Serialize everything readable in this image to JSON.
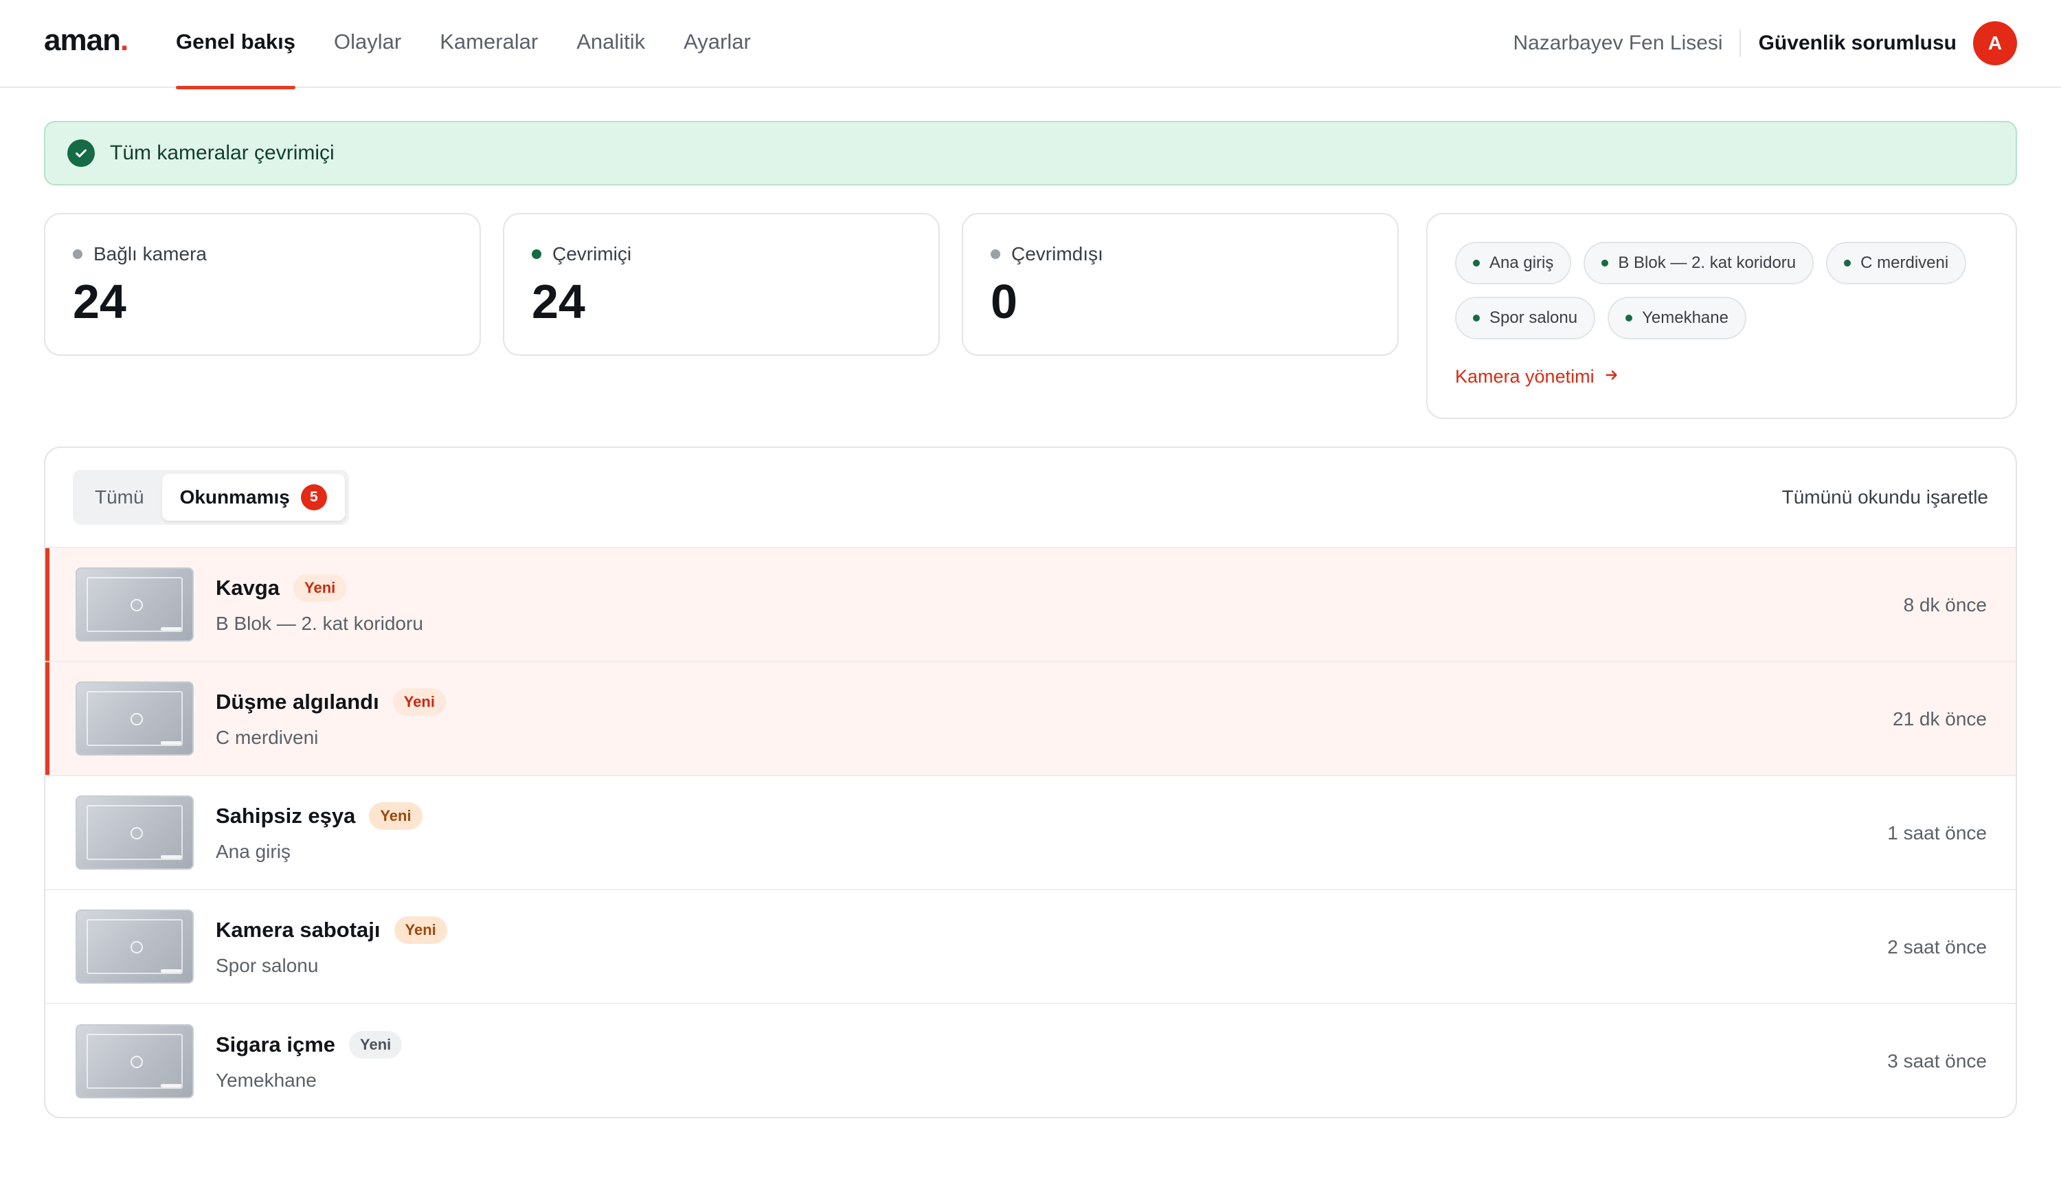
{
  "brand": {
    "name": "aman",
    "dot": "."
  },
  "nav": {
    "items": [
      {
        "label": "Genel bakış",
        "active": true
      },
      {
        "label": "Olaylar"
      },
      {
        "label": "Kameralar"
      },
      {
        "label": "Analitik"
      },
      {
        "label": "Ayarlar"
      }
    ]
  },
  "header": {
    "school": "Nazarbayev Fen Lisesi",
    "role": "Güvenlik sorumlusu",
    "avatar_initial": "A"
  },
  "banner": {
    "text": "Tüm kameralar çevrimiçi",
    "icon": "check-circle-icon"
  },
  "stats": [
    {
      "label": "Bağlı kamera",
      "value": "24",
      "dot_color": "#9aa0a6"
    },
    {
      "label": "Çevrimiçi",
      "value": "24",
      "dot_color": "#156b45"
    },
    {
      "label": "Çevrimdışı",
      "value": "0",
      "dot_color": "#9aa0a6"
    }
  ],
  "locations": {
    "chips": [
      "Ana giriş",
      "B Blok — 2. kat koridoru",
      "C merdiveni",
      "Spor salonu",
      "Yemekhane"
    ],
    "manage_label": "Kamera yönetimi",
    "manage_icon": "arrow-right-icon"
  },
  "events": {
    "tabs": {
      "all": "Tümü",
      "unread": "Okunmamış",
      "unread_count": "5"
    },
    "mark_all": "Tümünü okundu işaretle",
    "items": [
      {
        "title": "Kavga",
        "badge": "Yeni",
        "location": "B Blok — 2. kat koridoru",
        "time": "8 dk önce"
      },
      {
        "title": "Düşme algılandı",
        "badge": "Yeni",
        "location": "C merdiveni",
        "time": "21 dk önce"
      },
      {
        "title": "Sahipsiz eşya",
        "badge": "Yeni",
        "location": "Ana giriş",
        "time": "1 saat önce"
      },
      {
        "title": "Kamera sabotajı",
        "badge": "Yeni",
        "location": "Spor salonu",
        "time": "2 saat önce"
      },
      {
        "title": "Sigara içme",
        "badge": "Yeni",
        "location": "Yemekhane",
        "time": "3 saat önce"
      }
    ]
  },
  "colors": {
    "accent": "#e8391e",
    "success": "#156b45",
    "banner_bg": "#e0f5ea",
    "unread_bg": "#fff4f1"
  }
}
